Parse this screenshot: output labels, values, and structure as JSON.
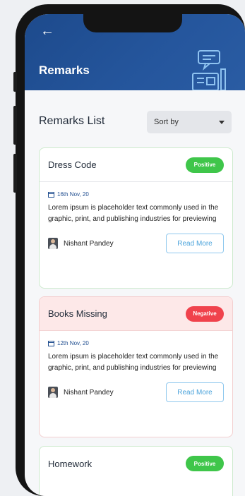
{
  "header": {
    "title": "Remarks",
    "back_icon": "arrow-left-icon"
  },
  "list": {
    "heading": "Remarks List",
    "sort_label": "Sort by"
  },
  "remarks": [
    {
      "title": "Dress Code",
      "status": "Positive",
      "date": "16th Nov, 20",
      "description": "Lorem ipsum is placeholder text commonly used in the graphic, print, and publishing industries for previewing",
      "author": "Nishant Pandey",
      "action": "Read More"
    },
    {
      "title": "Books Missing",
      "status": "Negative",
      "date": "12th Nov, 20",
      "description": "Lorem ipsum is placeholder text commonly used in the graphic, print, and publishing industries for previewing",
      "author": "Nishant Pandey",
      "action": "Read More"
    },
    {
      "title": "Homework",
      "status": "Positive"
    }
  ],
  "colors": {
    "header": "#1f4d8f",
    "positive": "#3fc64a",
    "negative": "#f0424c",
    "accent": "#4ba3db"
  }
}
